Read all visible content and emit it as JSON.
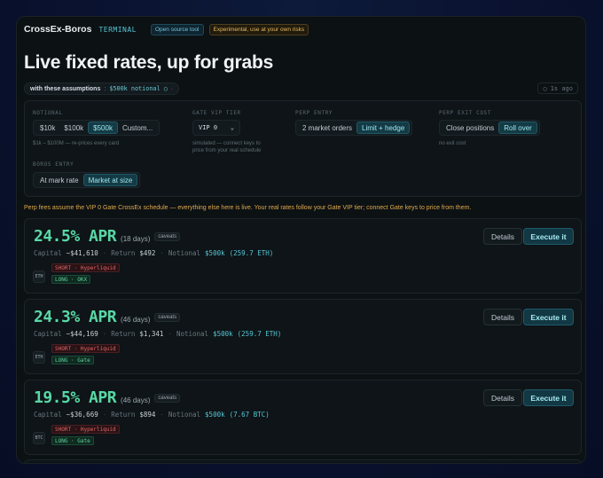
{
  "header": {
    "brand": "CrossEx-Boros",
    "terminal": "TERMINAL",
    "badge_open": "Open source tool",
    "badge_experimental": "Experimental, use at your own risks"
  },
  "headline": "Live fixed rates, up for grabs",
  "assumptions": {
    "label": "with these assumptions",
    "separator": ":",
    "value": "$500k notional ○",
    "chevron": "·",
    "ago": "1s ago"
  },
  "controls": {
    "notional": {
      "label": "NOTIONAL",
      "options": [
        "$10k",
        "$100k",
        "$500k",
        "Custom..."
      ],
      "selected": "$500k",
      "hint": "$1k – $100M — re-prices every card"
    },
    "vip": {
      "label": "GATE VIP TIER",
      "value": "VIP 0",
      "hint_line1": "simulated — connect keys to",
      "hint_line2": "price from your real schedule"
    },
    "perp_entry": {
      "label": "PERP ENTRY",
      "options": [
        "2 market orders",
        "Limit + hedge"
      ],
      "selected": "Limit + hedge"
    },
    "perp_exit": {
      "label": "PERP EXIT COST",
      "options": [
        "Close positions",
        "Roll over"
      ],
      "selected": "Roll over",
      "hint": "no exit cost"
    },
    "boros_entry": {
      "label": "BOROS ENTRY",
      "options": [
        "At mark rate",
        "Market at size"
      ],
      "selected": "Market at size"
    }
  },
  "note": "Perp fees assume the VIP 0 Gate CrossEx schedule — everything else here is live. Your real rates follow your Gate VIP tier; connect Gate keys to price from them.",
  "labels": {
    "capital": "Capital",
    "return": "Return",
    "notional": "Notional",
    "caveats": "caveats",
    "details": "Details",
    "execute": "Execute it"
  },
  "opportunities": [
    {
      "apr": "24.5% APR",
      "days": "(18 days)",
      "capital": "~$41,610",
      "return": "$492",
      "notional": "$500k",
      "notional_eq": "(259.7 ETH)",
      "coin": "ETH",
      "short": "SHORT · Hyperliquid",
      "long": "LONG · OKX"
    },
    {
      "apr": "24.3% APR",
      "days": "(46 days)",
      "capital": "~$44,169",
      "return": "$1,341",
      "notional": "$500k",
      "notional_eq": "(259.7 ETH)",
      "coin": "ETH",
      "short": "SHORT · Hyperliquid",
      "long": "LONG · Gate"
    },
    {
      "apr": "19.5% APR",
      "days": "(46 days)",
      "capital": "~$36,669",
      "return": "$894",
      "notional": "$500k",
      "notional_eq": "(7.67 BTC)",
      "coin": "BTC",
      "short": "SHORT · Hyperliquid",
      "long": "LONG · Gate"
    }
  ]
}
